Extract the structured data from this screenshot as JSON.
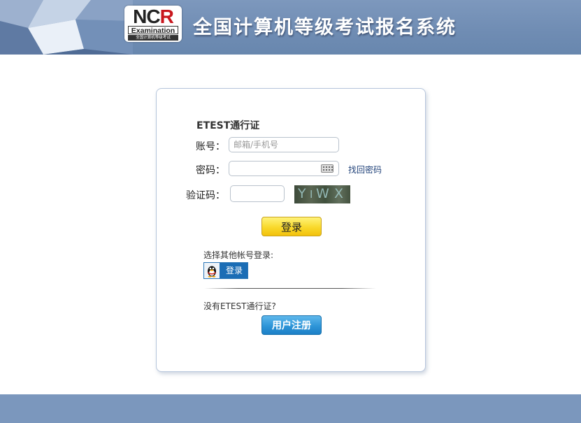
{
  "header": {
    "logo_main_n": "N",
    "logo_main_c": "C",
    "logo_main_r": "R",
    "logo_examination": "Examination",
    "logo_subtitle": "全国计算机等级考试",
    "site_title": "全国计算机等级考试报名系统"
  },
  "login": {
    "title": "ETEST通行证",
    "account_label": "账号：",
    "account_placeholder": "邮箱/手机号",
    "account_value": "",
    "password_label": "密码：",
    "password_value": "",
    "forgot_password": "找回密码",
    "captcha_label": "验证码：",
    "captcha_value": "",
    "captcha_chars": [
      "Y",
      "I",
      "W",
      "X"
    ],
    "login_button": "登录",
    "other_login_label": "选择其他帐号登录:",
    "qq_login_label": "登录",
    "no_account_text": "没有ETEST通行证?",
    "register_button": "用户注册"
  },
  "colors": {
    "header_bg": "#7391b8",
    "footer_bg": "#7b97bd",
    "login_button": "#f9d92b",
    "register_button": "#2e95d8",
    "link": "#22437a"
  },
  "icons": [
    "keyboard-icon",
    "qq-penguin-icon"
  ]
}
